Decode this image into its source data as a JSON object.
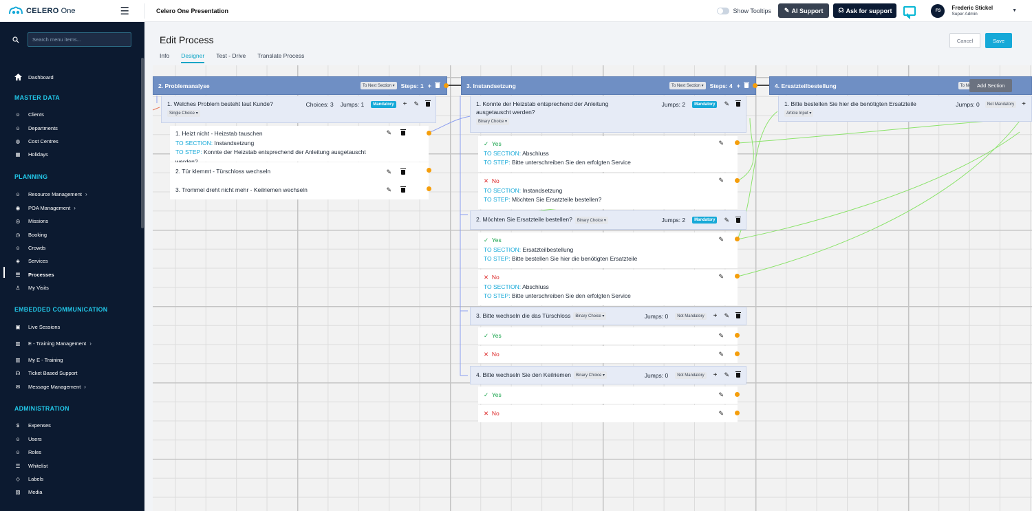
{
  "topbar": {
    "brand_name": "CELERO",
    "brand_sub": "One",
    "presentation": "Celero One Presentation",
    "show_tooltips": "Show Tooltips",
    "ai_support": "AI Support",
    "ask_support": "Ask for support",
    "user_initials": "FS",
    "user_name": "Frederic Stickel",
    "user_role": "Super Admin"
  },
  "sidebar": {
    "search_placeholder": "Search menu items...",
    "dashboard": "Dashboard",
    "sec_master": "MASTER DATA",
    "master": [
      "Clients",
      "Departments",
      "Cost Centres",
      "Holidays"
    ],
    "sec_planning": "PLANNING",
    "planning": [
      "Resource Management",
      "POA Management",
      "Missions",
      "Booking",
      "Crowds",
      "Services",
      "Processes",
      "My Visits"
    ],
    "sec_embedded": "EMBEDDED COMMUNICATION",
    "embedded": [
      "Live Sessions",
      "E - Training Management",
      "My E - Training",
      "Ticket Based Support",
      "Message Management"
    ],
    "sec_admin": "ADMINISTRATION",
    "admin": [
      "Expenses",
      "Users",
      "Roles",
      "Whitelist",
      "Labels",
      "Media"
    ]
  },
  "page": {
    "title": "Edit Process",
    "tabs": [
      "Info",
      "Designer",
      "Test - Drive",
      "Translate Process"
    ],
    "active_tab": "Designer",
    "cancel": "Cancel",
    "save": "Save",
    "add_section": "Add Section"
  },
  "sections": [
    {
      "title": "2. Problemanalyse",
      "mode": "To Next Section",
      "steps": "Steps: 1",
      "question": {
        "text": "1. Welches Problem besteht laut Kunde?",
        "type": "Single Choice",
        "choices": "Choices: 3",
        "jumps": "Jumps: 1",
        "badge": "Mandatory"
      },
      "options": [
        {
          "text": "1. Heizt nicht - Heizstab tauschen",
          "section_label": "TO SECTION:",
          "section": "Instandsetzung",
          "step_label": "TO STEP:",
          "step": "Konnte der Heizstab entsprechend der Anleitung ausgetauscht werden?"
        },
        {
          "text": "2. Tür klemmt - Türschloss wechseln"
        },
        {
          "text": "3. Trommel dreht nicht mehr - Keilriemen wechseln"
        }
      ]
    },
    {
      "title": "3. Instandsetzung",
      "mode": "To Next Section",
      "steps": "Steps: 4",
      "questions": [
        {
          "text": "1. Konnte der Heizstab entsprechend der Anleitung ausgetauscht werden?",
          "type": "Binary Choice",
          "jumps": "Jumps: 2",
          "badge": "Mandatory",
          "answers": [
            {
              "label": "Yes",
              "section_label": "TO SECTION:",
              "section": "Abschluss",
              "step_label": "TO STEP:",
              "step": "Bitte unterschreiben Sie den erfolgten Service"
            },
            {
              "label": "No",
              "section_label": "TO SECTION:",
              "section": "Instandsetzung",
              "step_label": "TO STEP:",
              "step": "Möchten Sie Ersatzteile bestellen?"
            }
          ]
        },
        {
          "text": "2. Möchten Sie Ersatzteile bestellen?",
          "type": "Binary Choice",
          "jumps": "Jumps: 2",
          "badge": "Mandatory",
          "answers": [
            {
              "label": "Yes",
              "section_label": "TO SECTION:",
              "section": "Ersatzteilbestellung",
              "step_label": "TO STEP:",
              "step": "Bitte bestellen Sie hier die benötigten Ersatzteile"
            },
            {
              "label": "No",
              "section_label": "TO SECTION:",
              "section": "Abschluss",
              "step_label": "TO STEP:",
              "step": "Bitte unterschreiben Sie den erfolgten Service"
            }
          ]
        },
        {
          "text": "3. Bitte wechseln die das Türschloss",
          "type": "Binary Choice",
          "jumps": "Jumps: 0",
          "badge": "Not Mandatory",
          "answers": [
            {
              "label": "Yes"
            },
            {
              "label": "No"
            }
          ]
        },
        {
          "text": "4. Bitte wechseln Sie den Keilriemen",
          "type": "Binary Choice",
          "jumps": "Jumps: 0",
          "badge": "Not Mandatory",
          "answers": [
            {
              "label": "Yes"
            },
            {
              "label": "No"
            }
          ]
        }
      ]
    },
    {
      "title": "4. Ersatzteilbestellung",
      "mode": "To Ne",
      "question": {
        "text": "1. Bitte bestellen Sie hier die benötigten Ersatzteile",
        "type": "Article Input",
        "jumps": "Jumps: 0",
        "badge": "Not Mandatory"
      }
    }
  ]
}
